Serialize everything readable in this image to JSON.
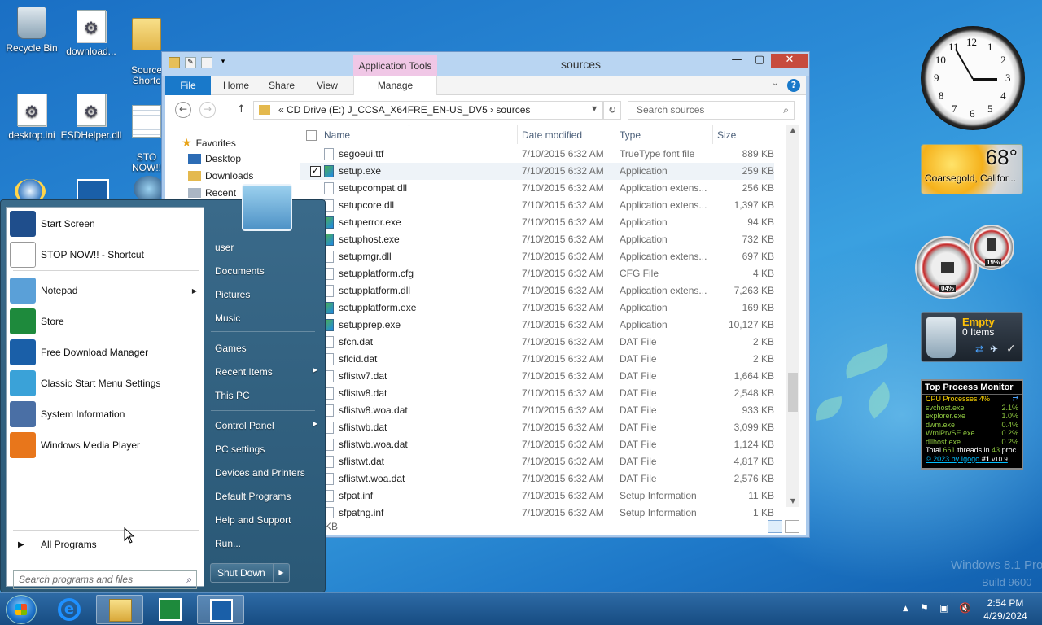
{
  "desktop": {
    "icons": [
      {
        "label": "Recycle Bin"
      },
      {
        "label": "download..."
      },
      {
        "label": "Source\nShortc"
      },
      {
        "label": "desktop.ini"
      },
      {
        "label": "ESDHelper.dll"
      },
      {
        "label": "STO\nNOW!!"
      }
    ]
  },
  "explorer": {
    "title": "sources",
    "context_tab": "Application Tools",
    "ribbon_tabs": [
      "File",
      "Home",
      "Share",
      "View",
      "Manage"
    ],
    "address": "«  CD Drive (E:) J_CCSA_X64FRE_EN-US_DV5  ›  sources",
    "search_placeholder": "Search sources",
    "nav": [
      "Favorites",
      "Desktop",
      "Downloads",
      "Recent"
    ],
    "columns": [
      "Name",
      "Date modified",
      "Type",
      "Size"
    ],
    "files": [
      {
        "name": "segoeui.ttf",
        "date": "7/10/2015 6:32 AM",
        "type": "TrueType font file",
        "size": "889 KB",
        "icon": "font"
      },
      {
        "name": "setup.exe",
        "date": "7/10/2015 6:32 AM",
        "type": "Application",
        "size": "259 KB",
        "icon": "app",
        "selected": true
      },
      {
        "name": "setupcompat.dll",
        "date": "7/10/2015 6:32 AM",
        "type": "Application extens...",
        "size": "256 KB",
        "icon": "dll"
      },
      {
        "name": "setupcore.dll",
        "date": "7/10/2015 6:32 AM",
        "type": "Application extens...",
        "size": "1,397 KB",
        "icon": "dll"
      },
      {
        "name": "setuperror.exe",
        "date": "7/10/2015 6:32 AM",
        "type": "Application",
        "size": "94 KB",
        "icon": "app"
      },
      {
        "name": "setuphost.exe",
        "date": "7/10/2015 6:32 AM",
        "type": "Application",
        "size": "732 KB",
        "icon": "app"
      },
      {
        "name": "setupmgr.dll",
        "date": "7/10/2015 6:32 AM",
        "type": "Application extens...",
        "size": "697 KB",
        "icon": "dll"
      },
      {
        "name": "setupplatform.cfg",
        "date": "7/10/2015 6:32 AM",
        "type": "CFG File",
        "size": "4 KB",
        "icon": "file"
      },
      {
        "name": "setupplatform.dll",
        "date": "7/10/2015 6:32 AM",
        "type": "Application extens...",
        "size": "7,263 KB",
        "icon": "dll"
      },
      {
        "name": "setupplatform.exe",
        "date": "7/10/2015 6:32 AM",
        "type": "Application",
        "size": "169 KB",
        "icon": "app"
      },
      {
        "name": "setupprep.exe",
        "date": "7/10/2015 6:32 AM",
        "type": "Application",
        "size": "10,127 KB",
        "icon": "app"
      },
      {
        "name": "sfcn.dat",
        "date": "7/10/2015 6:32 AM",
        "type": "DAT File",
        "size": "2 KB",
        "icon": "file"
      },
      {
        "name": "sflcid.dat",
        "date": "7/10/2015 6:32 AM",
        "type": "DAT File",
        "size": "2 KB",
        "icon": "file"
      },
      {
        "name": "sflistw7.dat",
        "date": "7/10/2015 6:32 AM",
        "type": "DAT File",
        "size": "1,664 KB",
        "icon": "file"
      },
      {
        "name": "sflistw8.dat",
        "date": "7/10/2015 6:32 AM",
        "type": "DAT File",
        "size": "2,548 KB",
        "icon": "file"
      },
      {
        "name": "sflistw8.woa.dat",
        "date": "7/10/2015 6:32 AM",
        "type": "DAT File",
        "size": "933 KB",
        "icon": "file"
      },
      {
        "name": "sflistwb.dat",
        "date": "7/10/2015 6:32 AM",
        "type": "DAT File",
        "size": "3,099 KB",
        "icon": "file"
      },
      {
        "name": "sflistwb.woa.dat",
        "date": "7/10/2015 6:32 AM",
        "type": "DAT File",
        "size": "1,124 KB",
        "icon": "file"
      },
      {
        "name": "sflistwt.dat",
        "date": "7/10/2015 6:32 AM",
        "type": "DAT File",
        "size": "4,817 KB",
        "icon": "file"
      },
      {
        "name": "sflistwt.woa.dat",
        "date": "7/10/2015 6:32 AM",
        "type": "DAT File",
        "size": "2,576 KB",
        "icon": "file"
      },
      {
        "name": "sfpat.inf",
        "date": "7/10/2015 6:32 AM",
        "type": "Setup Information",
        "size": "11 KB",
        "icon": "file"
      },
      {
        "name": "sfpatng.inf",
        "date": "7/10/2015 6:32 AM",
        "type": "Setup Information",
        "size": "1 KB",
        "icon": "file"
      }
    ],
    "status_text": "KB"
  },
  "start_menu": {
    "left_items": [
      {
        "label": "Start Screen",
        "icon": "start-screen-icon",
        "color": "#1f4e8c"
      },
      {
        "label": "STOP NOW!! - Shortcut",
        "icon": "document-icon",
        "color": "#ffffff"
      },
      {
        "label": "Notepad",
        "icon": "notepad-icon",
        "color": "#5aa0d8",
        "submenu": true
      },
      {
        "label": "Store",
        "icon": "store-icon",
        "color": "#1e8a3c"
      },
      {
        "label": "Free Download Manager",
        "icon": "fdm-icon",
        "color": "#1a5fa8"
      },
      {
        "label": "Classic Start Menu Settings",
        "icon": "shell-icon",
        "color": "#3aa2d8"
      },
      {
        "label": "System Information",
        "icon": "system-info-icon",
        "color": "#4a6fa5"
      },
      {
        "label": "Windows Media Player",
        "icon": "media-player-icon",
        "color": "#e8761b"
      }
    ],
    "all_programs": "All Programs",
    "search_placeholder": "Search programs and files",
    "right_items": [
      {
        "label": "user"
      },
      {
        "label": "Documents"
      },
      {
        "label": "Pictures"
      },
      {
        "label": "Music"
      },
      {
        "label": "Games"
      },
      {
        "label": "Recent Items",
        "submenu": true
      },
      {
        "label": "This PC"
      },
      {
        "label": "Control Panel",
        "submenu": true
      },
      {
        "label": "PC settings"
      },
      {
        "label": "Devices and Printers"
      },
      {
        "label": "Default Programs"
      },
      {
        "label": "Help and Support"
      },
      {
        "label": "Run..."
      }
    ],
    "shutdown": "Shut Down"
  },
  "gadgets": {
    "clock_numbers": [
      "12",
      "1",
      "2",
      "3",
      "4",
      "5",
      "6",
      "7",
      "8",
      "9",
      "10",
      "11"
    ],
    "weather": {
      "temp": "68°",
      "location": "Coarsegold, Califor..."
    },
    "meters": {
      "cpu_label": "04%",
      "mem_label": "19%"
    },
    "recycle": {
      "state": "Empty",
      "count": "0 Items"
    },
    "top_process": {
      "title": "Top Process Monitor",
      "cpu_line": "CPU Processes 4%",
      "processes": [
        {
          "name": "svchost.exe",
          "pct": "2.1%"
        },
        {
          "name": "explorer.exe",
          "pct": "1.0%"
        },
        {
          "name": "dwm.exe",
          "pct": "0.4%"
        },
        {
          "name": "WmiPrvSE.exe",
          "pct": "0.2%"
        },
        {
          "name": "dllhost.exe",
          "pct": "0.2%"
        }
      ],
      "total_prefix": "Total",
      "threads": "661",
      "threads_mid": "threads in",
      "procs": "43",
      "procs_suffix": "proc",
      "credit": "© 2023 by Igogo",
      "rank": "#1",
      "version": "v10.9"
    }
  },
  "watermark": {
    "line1": "Windows 8.1 Pro",
    "line2": "Build 9600"
  },
  "taskbar": {
    "time": "2:54 PM",
    "date": "4/29/2024",
    "buttons": [
      "internet-explorer-icon",
      "file-explorer-icon",
      "store-icon",
      "fdm-icon"
    ]
  },
  "colors": {
    "accent": "#1979ca",
    "taskbar": "#1f5a92",
    "close": "#c74b3d"
  }
}
